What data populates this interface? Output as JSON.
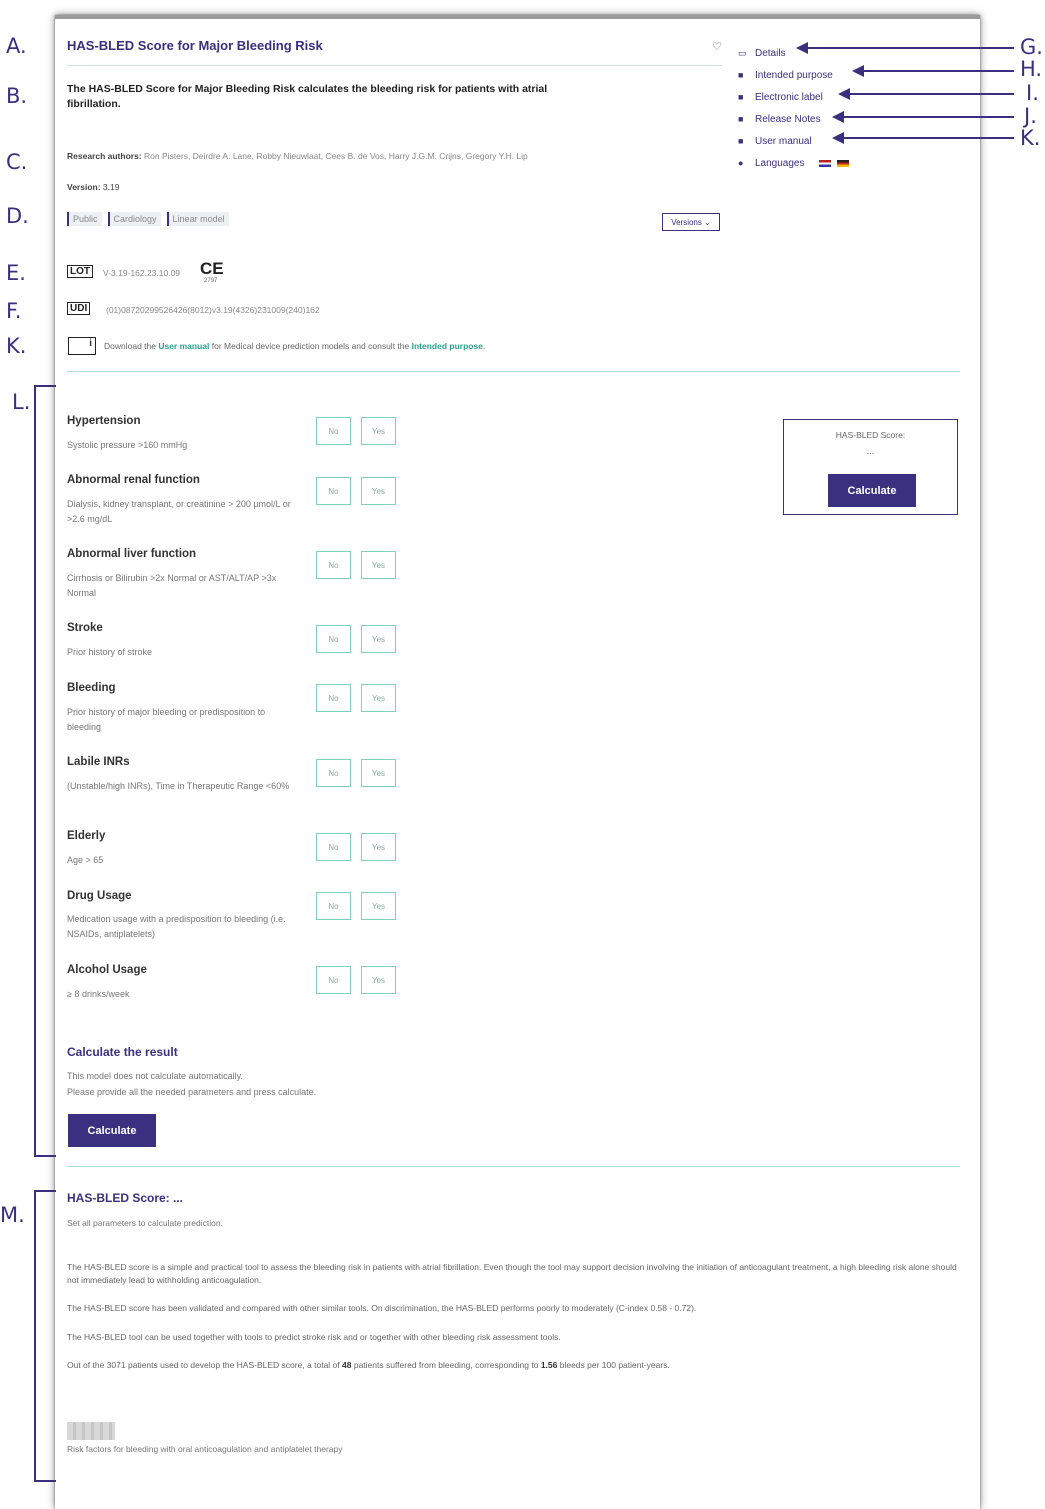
{
  "callouts_left": [
    "A.",
    "B.",
    "C.",
    "D.",
    "E.",
    "F.",
    "K.",
    "L.",
    "M."
  ],
  "callouts_right": [
    "G.",
    "H.",
    "I.",
    "J.",
    "K."
  ],
  "header": {
    "title": "HAS-BLED Score for Major Bleeding Risk",
    "description": "The HAS-BLED Score for Major Bleeding Risk calculates the bleeding risk for patients with atrial fibrillation.",
    "authors_label": "Research authors:",
    "authors": "Ron Pisters, Deirdre A. Lane, Robby Nieuwlaat, Cees B. de Vos, Harry J.G.M. Crijns, Gregory Y.H. Lip",
    "version_label": "Version:",
    "version": "3.19",
    "tags": [
      "Public",
      "Cardiology",
      "Linear model"
    ],
    "versions_button": "Versions ⌄"
  },
  "sidebar": {
    "links": [
      {
        "label": "Details",
        "icon": "book-icon"
      },
      {
        "label": "Intended purpose",
        "icon": "document-icon"
      },
      {
        "label": "Electronic label",
        "icon": "document-icon"
      },
      {
        "label": "Release Notes",
        "icon": "document-icon"
      },
      {
        "label": "User manual",
        "icon": "document-icon"
      },
      {
        "label": "Languages",
        "icon": "globe-icon"
      }
    ]
  },
  "regulatory": {
    "lot_label": "LOT",
    "lot_value": "V-3.19-162.23.10.09",
    "ce_mark": "CE",
    "ce_number": "2797",
    "udi_label": "UDI",
    "udi_value": "(01)08720299526426(8012)v3.19(4326)231009(240)162",
    "manual_prefix": "Download the ",
    "manual_link": "User manual",
    "manual_middle": " for Medical device prediction models and consult the ",
    "purpose_link": "Intended purpose",
    "manual_suffix": "."
  },
  "parameters": [
    {
      "name": "Hypertension",
      "desc": "Systolic pressure >160 mmHg"
    },
    {
      "name": "Abnormal renal function",
      "desc": "Dialysis, kidney transplant, or creatinine > 200 µmol/L or >2.6 mg/dL"
    },
    {
      "name": "Abnormal liver function",
      "desc": "Cirrhosis or Bilirubin >2x Normal or AST/ALT/AP >3x Normal"
    },
    {
      "name": "Stroke",
      "desc": "Prior history of stroke"
    },
    {
      "name": "Bleeding",
      "desc": "Prior history of major bleeding or predisposition to bleeding"
    },
    {
      "name": "Labile INRs",
      "desc": "(Unstable/high INRs), Time in Therapeutic Range <60%"
    },
    {
      "name": "Elderly",
      "desc": "Age > 65"
    },
    {
      "name": "Drug Usage",
      "desc": "Medication usage with a predisposition to bleeding (i.e. NSAIDs, antiplatelets)"
    },
    {
      "name": "Alcohol Usage",
      "desc": "≥ 8 drinks/week"
    }
  ],
  "buttons": {
    "no": "No",
    "yes": "Yes",
    "calculate": "Calculate"
  },
  "score_box": {
    "label": "HAS-BLED Score:",
    "value": "..."
  },
  "calc_section": {
    "title": "Calculate the result",
    "line1": "This model does not calculate automatically.",
    "line2": "Please provide all the needed parameters and press calculate."
  },
  "result": {
    "title": "HAS-BLED Score: ...",
    "subtitle": "Set all parameters to calculate prediction.",
    "para1": "The HAS-BLED score is a simple and practical tool to assess the bleeding risk in patients with atrial fibrillation. Even though the tool may support decision involving the initiation of anticoagulant treatment, a high bleeding risk alone should not immediately lead to withholding anticoagulation.",
    "para2": "The HAS-BLED score has been validated and compared with other similar tools. On discrimination, the HAS-BLED performs poorly to moderately (C-index 0.58 - 0.72).",
    "para3": "The HAS-BLED tool can be used together with tools to predict stroke risk and or together with other bleeding risk assessment tools.",
    "para4_a": "Out of the 3071 patients used to develop the HAS-BLED score, a total of ",
    "para4_b": "48",
    "para4_c": " patients suffered from bleeding, corresponding to ",
    "para4_d": "1.56",
    "para4_e": " bleeds per 100 patient-years.",
    "caption": "Risk factors for bleeding with oral anticoagulation and antiplatelet therapy"
  },
  "colors": {
    "accent": "#3b2f80",
    "teal": "#2aa38a",
    "divider": "#b6dcd1"
  }
}
